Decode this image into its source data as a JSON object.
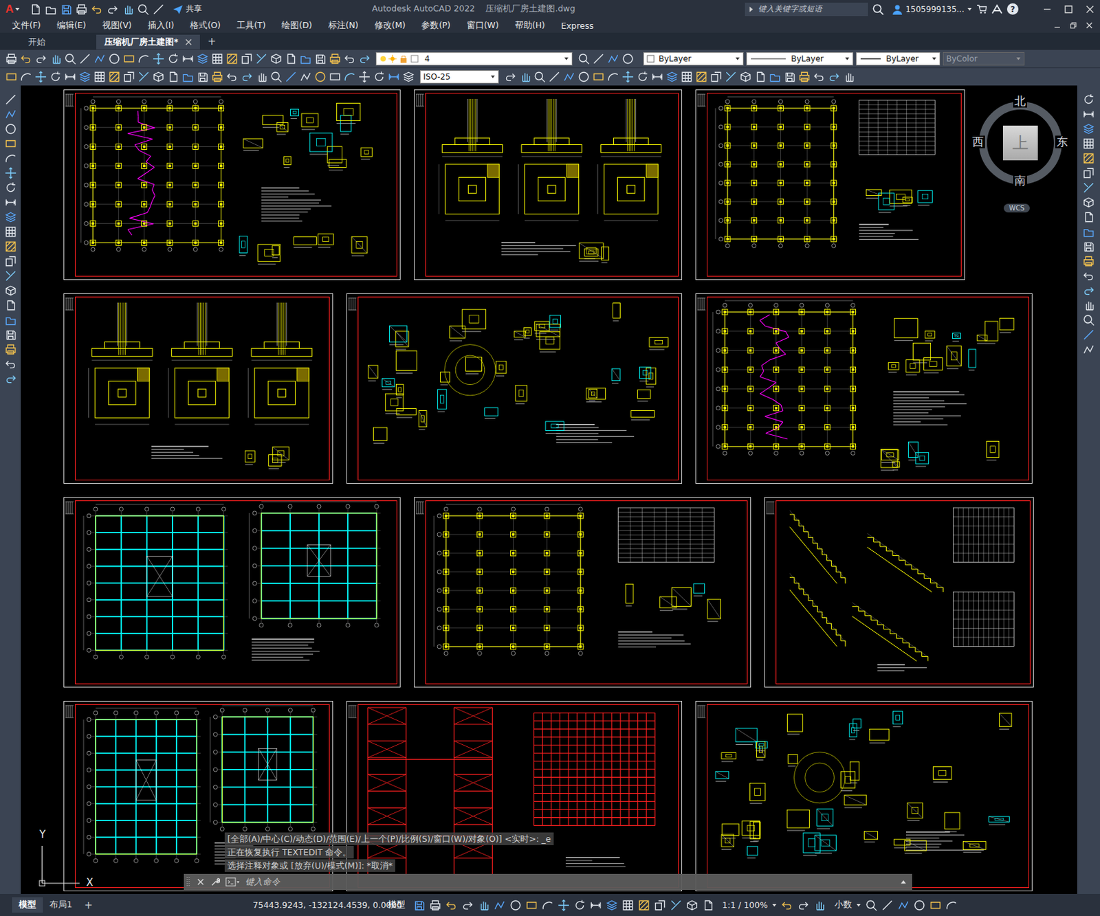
{
  "title_bar": {
    "app_icon": "A",
    "share": "共享",
    "title": "Autodesk AutoCAD 2022    压缩机厂房土建图.dwg",
    "search_placeholder": "键入关键字或短语",
    "user": "1505999135...",
    "help": "?"
  },
  "menu": [
    "文件(F)",
    "编辑(E)",
    "视图(V)",
    "插入(I)",
    "格式(O)",
    "工具(T)",
    "绘图(D)",
    "标注(N)",
    "修改(M)",
    "参数(P)",
    "窗口(W)",
    "帮助(H)",
    "Express"
  ],
  "doc_tabs": [
    {
      "label": "开始",
      "selected": false
    },
    {
      "label": "压缩机厂房土建图*",
      "selected": true
    }
  ],
  "new_tab": "+",
  "layer_props": {
    "layer": "4",
    "color": "ByLayer",
    "linetype": "ByLayer",
    "lineweight": "ByLayer",
    "plot_style": {
      "label": "ByColor",
      "disabled": true
    }
  },
  "dim_style": "ISO-25",
  "viewcube": {
    "north": "北",
    "south": "南",
    "west": "西",
    "east": "东",
    "top": "上",
    "wcs": "WCS"
  },
  "sheets": [
    {
      "kind": "foundation-plan"
    },
    {
      "kind": "footings"
    },
    {
      "kind": "column-grid"
    },
    {
      "kind": "footings"
    },
    {
      "kind": "details"
    },
    {
      "kind": "foundation-plan"
    },
    {
      "kind": "framing"
    },
    {
      "kind": "column-grid"
    },
    {
      "kind": "stairs"
    },
    {
      "kind": "framing"
    },
    {
      "kind": "truss"
    },
    {
      "kind": "details"
    }
  ],
  "ucs": {
    "x": "X",
    "y": "Y"
  },
  "command": {
    "history": [
      "[全部(A)/中心(C)/动态(D)/范围(E)/上一个(P)/比例(S)/窗口(W)/对象(O)] <实时>: _e",
      "正在恢复执行 TEXTEDIT 命令。",
      "选择注释对象或 [放弃(U)/模式(M)]: *取消*"
    ],
    "placeholder": "键入命令"
  },
  "layout_tabs": [
    {
      "label": "模型",
      "selected": true
    },
    {
      "label": "布局1",
      "selected": false
    }
  ],
  "layout_add": "+",
  "status_bar": {
    "coords": "75443.9243, -132124.4539, 0.0000",
    "space": "模型",
    "scale": "1:1 / 100%",
    "units": "小数"
  }
}
